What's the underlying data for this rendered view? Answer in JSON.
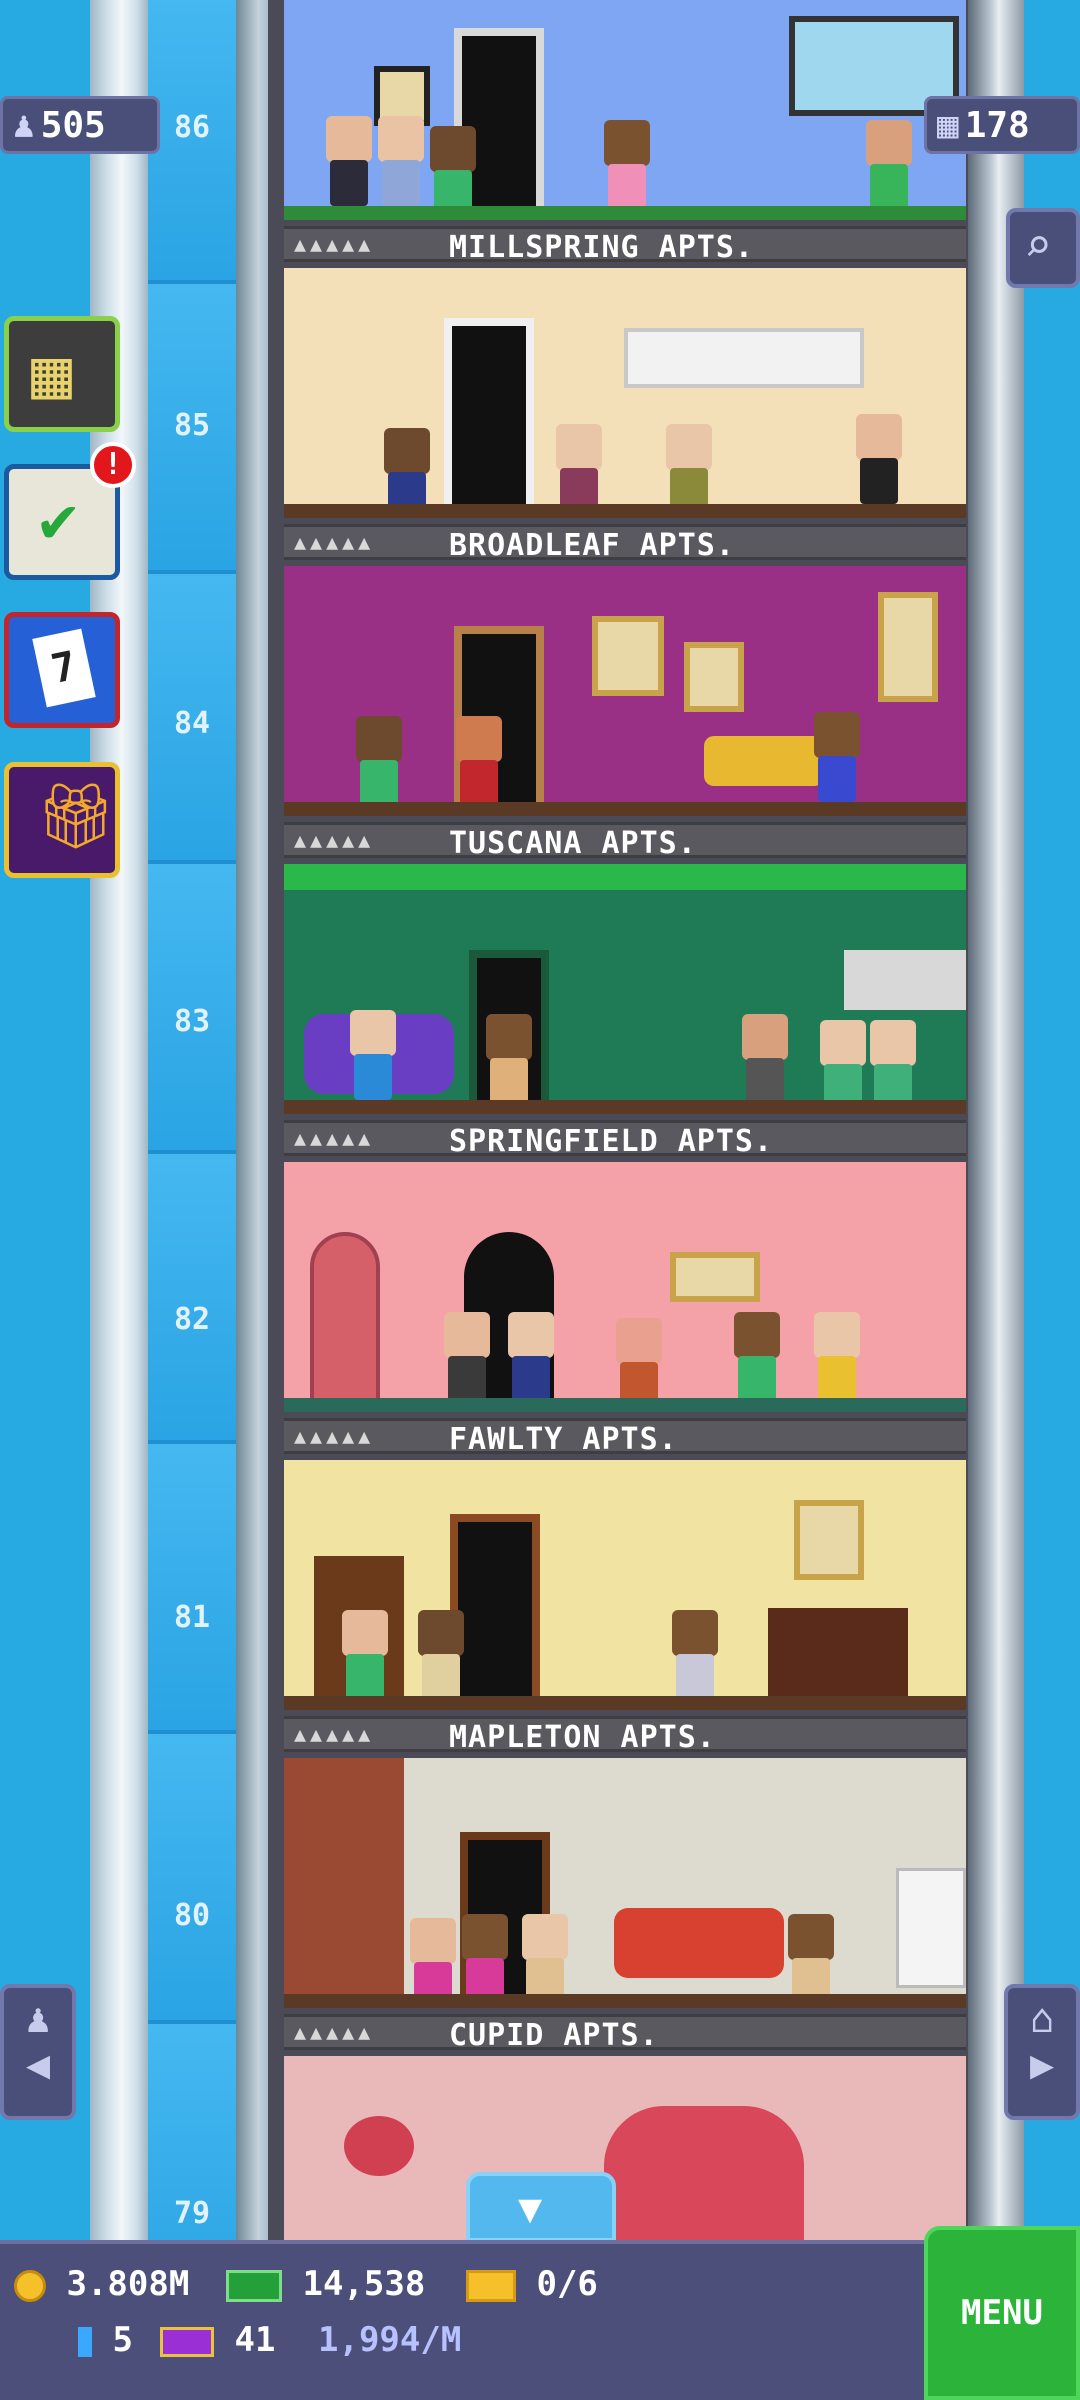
{
  "counters": {
    "population": "505",
    "floors": "178"
  },
  "floor_numbers": [
    "86",
    "85",
    "84",
    "83",
    "82",
    "81",
    "80",
    "79"
  ],
  "floors": [
    {
      "name": "MILLSPRING APTS.",
      "color": "#7fa6f2"
    },
    {
      "name": "BROADLEAF APTS.",
      "color": "#f3dfb8"
    },
    {
      "name": "TUSCANA APTS.",
      "color": "#9a2f86"
    },
    {
      "name": "SPRINGFIELD APTS.",
      "color": "#1f7b55"
    },
    {
      "name": "FAWLTY APTS.",
      "color": "#f4a2a7"
    },
    {
      "name": "MAPLETON APTS.",
      "color": "#f1e3a2"
    },
    {
      "name": "CUPID APTS.",
      "color": "#dddad0"
    },
    {
      "name": "",
      "color": "#e9b9ba"
    }
  ],
  "side_buttons": {
    "badge_count": "!",
    "calendar_day": "7"
  },
  "hud": {
    "coins": "3.808M",
    "bux": "14,538",
    "tickets": "0/6",
    "batteries": "5",
    "vip": "41",
    "rate": "1,994/M",
    "menu_label": "MENU"
  }
}
